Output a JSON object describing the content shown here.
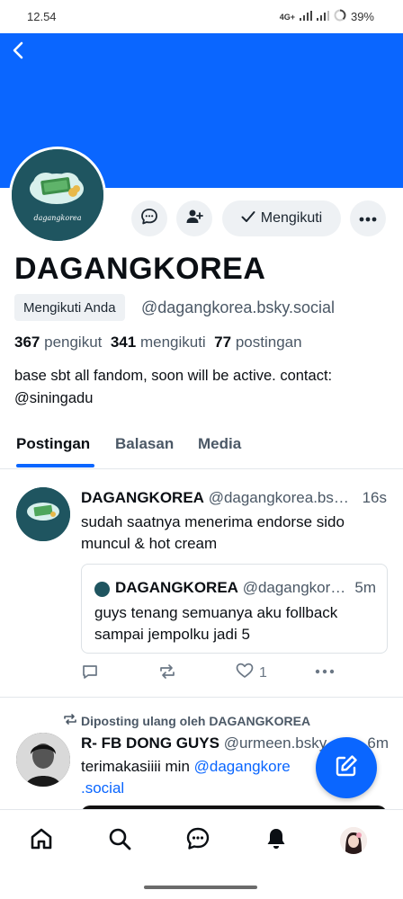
{
  "status_bar": {
    "time": "12.54",
    "network": "4G+",
    "battery": "39%"
  },
  "colors": {
    "accent": "#0a66ff",
    "banner": "#0a66ff",
    "muted": "#4b5866"
  },
  "header": {
    "back_icon": "chevron-left-icon"
  },
  "profile": {
    "display_name": "DAGANGKOREA",
    "follows_you": "Mengikuti Anda",
    "handle": "@dagangkorea.bsky.social",
    "followers_count": "367",
    "followers_label": "pengikut",
    "following_count": "341",
    "following_label": "mengikuti",
    "posts_count": "77",
    "posts_label": "postingan",
    "bio_line1": "base sbt all fandom, soon will be active. contact:",
    "bio_line2": "@siningadu",
    "avatar_text": "dagangkorea"
  },
  "actions": {
    "message_icon": "chat-bubble-icon",
    "add_user_icon": "person-add-icon",
    "follow_label": "Mengikuti",
    "more_icon": "ellipsis-icon"
  },
  "tabs": [
    {
      "label": "Postingan",
      "active": true
    },
    {
      "label": "Balasan",
      "active": false
    },
    {
      "label": "Media",
      "active": false
    }
  ],
  "posts": [
    {
      "author": "DAGANGKOREA",
      "handle": "@dagangkorea.bs…",
      "time": "16s",
      "text_line1": "sudah saatnya menerima endorse sido",
      "text_line2": "muncul & hot cream",
      "quote": {
        "author": "DAGANGKOREA",
        "handle": "@dagangkor…",
        "time": "5m",
        "text_line1": "guys tenang semuanya aku follback",
        "text_line2": "sampai jempolku jadi 5"
      },
      "like_count": "1"
    },
    {
      "repost_label": "Diposting ulang oleh DAGANGKOREA",
      "author": "R- FB DONG GUYS",
      "handle": "@urmeen.bsky",
      "time": "6m",
      "text_start": "terimakasiiii min ",
      "mention_line1": "@dagangkore",
      "mention_line2": ".social"
    }
  ],
  "bottom_nav": [
    "home-icon",
    "search-icon",
    "chat-icon",
    "bell-icon",
    "profile-avatar"
  ]
}
